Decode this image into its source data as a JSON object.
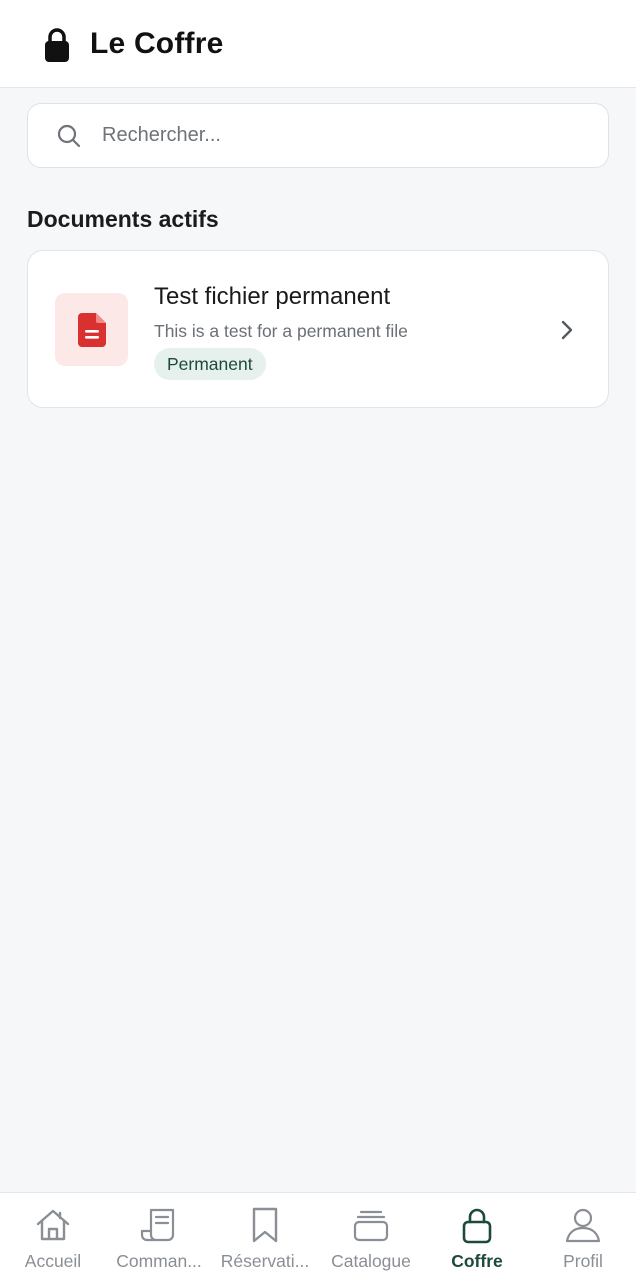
{
  "header": {
    "title": "Le Coffre",
    "icon": "lock-icon"
  },
  "search": {
    "placeholder": "Rechercher...",
    "value": "",
    "icon": "search-icon"
  },
  "section": {
    "title": "Documents actifs"
  },
  "documents": [
    {
      "title": "Test fichier permanent",
      "description": "This is a test for a permanent file",
      "badge": "Permanent",
      "icon": "file-document-icon",
      "icon_color": "#d93030",
      "thumb_bg": "#fde8e8"
    }
  ],
  "nav": {
    "active_color": "#1e4a3c",
    "inactive_color": "#8a8f96",
    "items": [
      {
        "label": "Accueil",
        "icon": "home-icon",
        "active": false
      },
      {
        "label": "Comman...",
        "icon": "receipt-icon",
        "active": false
      },
      {
        "label": "Réservati...",
        "icon": "bookmark-icon",
        "active": false
      },
      {
        "label": "Catalogue",
        "icon": "catalog-icon",
        "active": false
      },
      {
        "label": "Coffre",
        "icon": "lock-icon",
        "active": true
      },
      {
        "label": "Profil",
        "icon": "user-icon",
        "active": false
      }
    ]
  }
}
